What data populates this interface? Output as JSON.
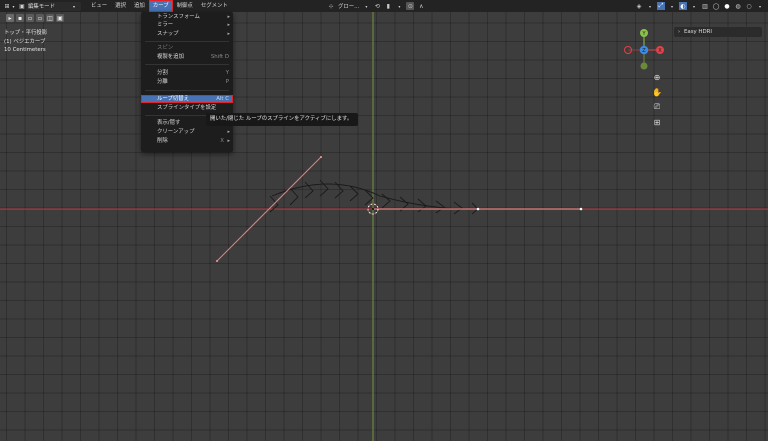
{
  "header": {
    "mode_label": "編集モード",
    "menus": [
      "ビュー",
      "選択",
      "追加",
      "カーブ",
      "制御点",
      "セグメント"
    ],
    "active_menu_index": 3,
    "transform_orientation": "グロー..."
  },
  "viewport_info": {
    "line1": "トップ・平行投影",
    "line2": "(1) ベジエカーブ",
    "line3": "10 Centimeters"
  },
  "dropdown": {
    "items": [
      {
        "label": "トランスフォーム",
        "shortcut": "",
        "submenu": true,
        "disabled": false,
        "highlighted": false
      },
      {
        "label": "ミラー",
        "shortcut": "",
        "submenu": true,
        "disabled": false,
        "highlighted": false
      },
      {
        "label": "スナップ",
        "shortcut": "",
        "submenu": true,
        "disabled": false,
        "highlighted": false
      },
      {
        "label": "スピン",
        "shortcut": "",
        "submenu": false,
        "disabled": true,
        "highlighted": false
      },
      {
        "label": "複製を追加",
        "shortcut": "Shift D",
        "submenu": false,
        "disabled": false,
        "highlighted": false
      },
      {
        "label": "分割",
        "shortcut": "Y",
        "submenu": false,
        "disabled": false,
        "highlighted": false
      },
      {
        "label": "分離",
        "shortcut": "P",
        "submenu": false,
        "disabled": false,
        "highlighted": false
      },
      {
        "label": "ループ切替え",
        "shortcut": "Alt C",
        "submenu": false,
        "disabled": false,
        "highlighted": true
      },
      {
        "label": "スプラインタイプを設定",
        "shortcut": "",
        "submenu": false,
        "disabled": false,
        "highlighted": false
      },
      {
        "label": "表示/隠す",
        "shortcut": "",
        "submenu": true,
        "disabled": false,
        "highlighted": false
      },
      {
        "label": "クリーンアップ",
        "shortcut": "",
        "submenu": true,
        "disabled": false,
        "highlighted": false
      },
      {
        "label": "削除",
        "shortcut": "X",
        "submenu": true,
        "disabled": false,
        "highlighted": false
      }
    ]
  },
  "tooltip": {
    "text": "開いた/閉じた ループのスプラインをアクティブにします。"
  },
  "npanel": {
    "tab_label": "Easy HDRI"
  },
  "gizmo": {
    "x_label": "X",
    "y_label": "Y",
    "z_label": "Z",
    "x_color": "#e0434a",
    "y_color": "#8bc34a",
    "z_color": "#3d8be0"
  },
  "colors": {
    "accent": "#4772b3",
    "highlight_box": "#e0242b",
    "x_axis": "#b8424a",
    "y_axis": "#7aa13e",
    "curve": "#e88080"
  }
}
